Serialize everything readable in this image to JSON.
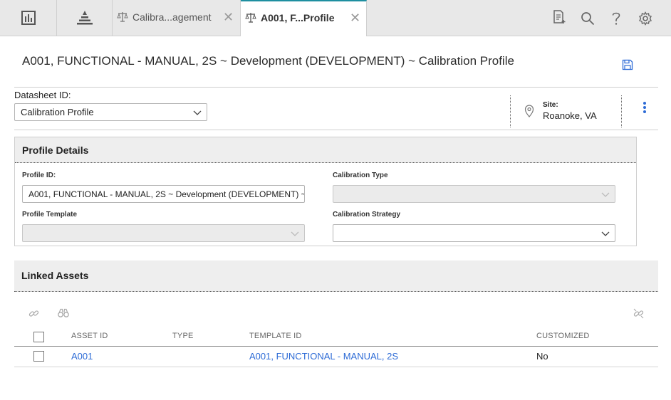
{
  "tabs": [
    {
      "label": "Calibra...agement",
      "close": "✕",
      "active": false
    },
    {
      "label": "A001, F...Profile",
      "close": "✕",
      "active": true
    }
  ],
  "page_title": "A001, FUNCTIONAL - MANUAL, 2S ~ Development (DEVELOPMENT) ~ Calibration Profile",
  "datasheet": {
    "label": "Datasheet ID:",
    "value": "Calibration Profile"
  },
  "site": {
    "label": "Site:",
    "value": "Roanoke, VA"
  },
  "profile_details": {
    "title": "Profile Details",
    "profile_id_label": "Profile ID:",
    "profile_id_value": "A001, FUNCTIONAL - MANUAL, 2S ~ Development (DEVELOPMENT) ~",
    "calibration_type_label": "Calibration Type",
    "calibration_type_value": "",
    "profile_template_label": "Profile Template",
    "profile_template_value": "",
    "calibration_strategy_label": "Calibration Strategy",
    "calibration_strategy_value": ""
  },
  "linked_assets": {
    "title": "Linked Assets",
    "columns": [
      "ASSET ID",
      "TYPE",
      "TEMPLATE ID",
      "CUSTOMIZED"
    ],
    "rows": [
      {
        "asset_id": "A001",
        "type": "",
        "template_id": "A001, FUNCTIONAL - MANUAL, 2S",
        "customized": "No"
      }
    ]
  },
  "colors": {
    "accent": "#1e8fa0",
    "link": "#2d6bd6"
  },
  "icons": [
    "dashboard-icon",
    "hierarchy-icon",
    "scale-icon",
    "new-doc-icon",
    "search-icon",
    "help-icon",
    "gear-icon",
    "save-icon",
    "location-pin-icon",
    "kebab-icon",
    "link-icon",
    "binoculars-icon",
    "unlink-icon",
    "chevron-down-icon"
  ]
}
